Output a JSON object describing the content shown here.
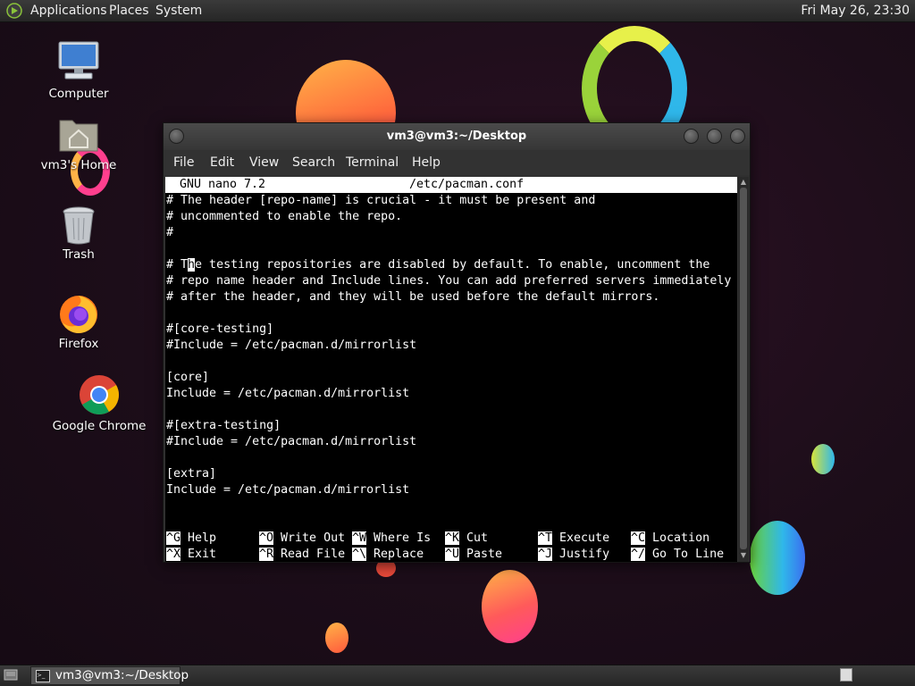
{
  "top_panel": {
    "menu": [
      "Applications",
      "Places",
      "System"
    ],
    "clock": "Fri May 26, 23:30"
  },
  "desktop_icons": [
    {
      "label": "Computer",
      "icon": "computer-icon"
    },
    {
      "label": "vm3's Home",
      "icon": "home-folder-icon"
    },
    {
      "label": "Trash",
      "icon": "trash-icon"
    },
    {
      "label": "Firefox",
      "icon": "firefox-icon"
    },
    {
      "label": "Google Chrome",
      "icon": "chrome-icon"
    }
  ],
  "window": {
    "title": "vm3@vm3:~/Desktop",
    "menu": [
      "File",
      "Edit",
      "View",
      "Search",
      "Terminal",
      "Help"
    ]
  },
  "nano": {
    "version": "GNU nano 7.2",
    "filename": "/etc/pacman.conf",
    "lines": [
      "# The header [repo-name] is crucial - it must be present and",
      "# uncommented to enable the repo.",
      "#",
      "",
      "# The testing repositories are disabled by default. To enable, uncomment the",
      "# repo name header and Include lines. You can add preferred servers immediately",
      "# after the header, and they will be used before the default mirrors.",
      "",
      "#[core-testing]",
      "#Include = /etc/pacman.d/mirrorlist",
      "",
      "[core]",
      "Include = /etc/pacman.d/mirrorlist",
      "",
      "#[extra-testing]",
      "#Include = /etc/pacman.d/mirrorlist",
      "",
      "[extra]",
      "Include = /etc/pacman.d/mirrorlist"
    ],
    "cursor": {
      "line": 4,
      "col": 3
    },
    "shortcuts": [
      [
        {
          "key": "^G",
          "label": "Help"
        },
        {
          "key": "^O",
          "label": "Write Out"
        },
        {
          "key": "^W",
          "label": "Where Is"
        },
        {
          "key": "^K",
          "label": "Cut"
        },
        {
          "key": "^T",
          "label": "Execute"
        },
        {
          "key": "^C",
          "label": "Location"
        }
      ],
      [
        {
          "key": "^X",
          "label": "Exit"
        },
        {
          "key": "^R",
          "label": "Read File"
        },
        {
          "key": "^\\",
          "label": "Replace"
        },
        {
          "key": "^U",
          "label": "Paste"
        },
        {
          "key": "^J",
          "label": "Justify"
        },
        {
          "key": "^/",
          "label": "Go To Line"
        }
      ]
    ]
  },
  "taskbar": {
    "task_label": "vm3@vm3:~/Desktop"
  },
  "colors": {
    "desktop_bg": "#1c0d19",
    "terminal_bg": "#000000",
    "terminal_fg": "#ffffff",
    "panel_bg": "#2e2e2e"
  }
}
